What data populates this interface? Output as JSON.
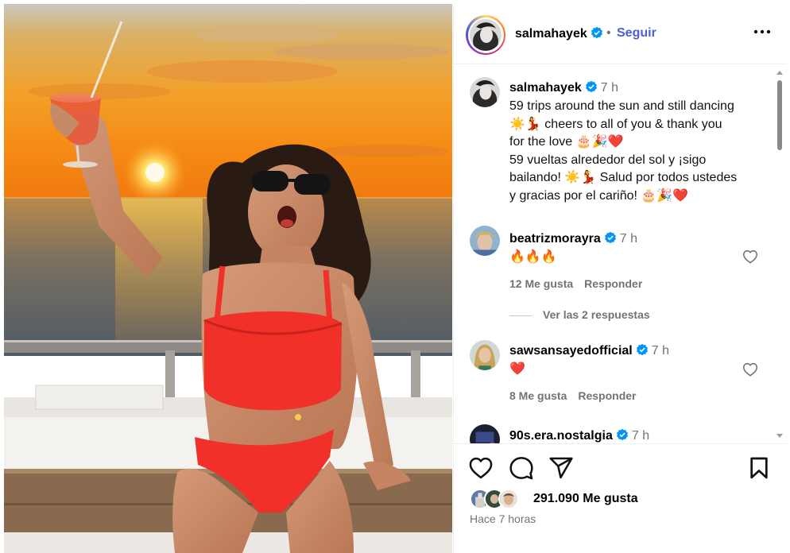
{
  "post": {
    "author": "salmahayek",
    "follow_label": "Seguir",
    "dot": "•",
    "more_icon": "more-horizontal-icon"
  },
  "caption": {
    "username": "salmahayek",
    "time": "7 h",
    "lines": [
      "59 trips around the sun and still dancing",
      "☀️💃 cheers to all of you & thank you",
      "for the love 🎂🎉❤️",
      "59 vueltas alrededor del sol y ¡sigo",
      "bailando! ☀️💃 Salud por todos ustedes",
      "y gracias por el cariño! 🎂🎉❤️"
    ]
  },
  "comments": [
    {
      "username": "beatrizmorayra",
      "time": "7 h",
      "text": "🔥🔥🔥",
      "likes": "12 Me gusta",
      "reply": "Responder"
    },
    {
      "username": "sawsansayedofficial",
      "time": "7 h",
      "text": "❤️",
      "likes": "8 Me gusta",
      "reply": "Responder"
    },
    {
      "username": "90s.era.nostalgia",
      "time": "7 h",
      "text": "",
      "likes": "",
      "reply": ""
    }
  ],
  "replies_label": "Ver las 2 respuestas",
  "actions": {
    "icons": [
      "heart-icon",
      "comment-icon",
      "share-icon",
      "bookmark-icon"
    ],
    "likes_count": "291.090 Me gusta",
    "posted_ago": "Hace 7 horas"
  },
  "colors": {
    "link_blue": "#4a5fd8",
    "verified_blue": "#0095f6",
    "muted": "#737373",
    "bikini_red": "#f2302a"
  }
}
